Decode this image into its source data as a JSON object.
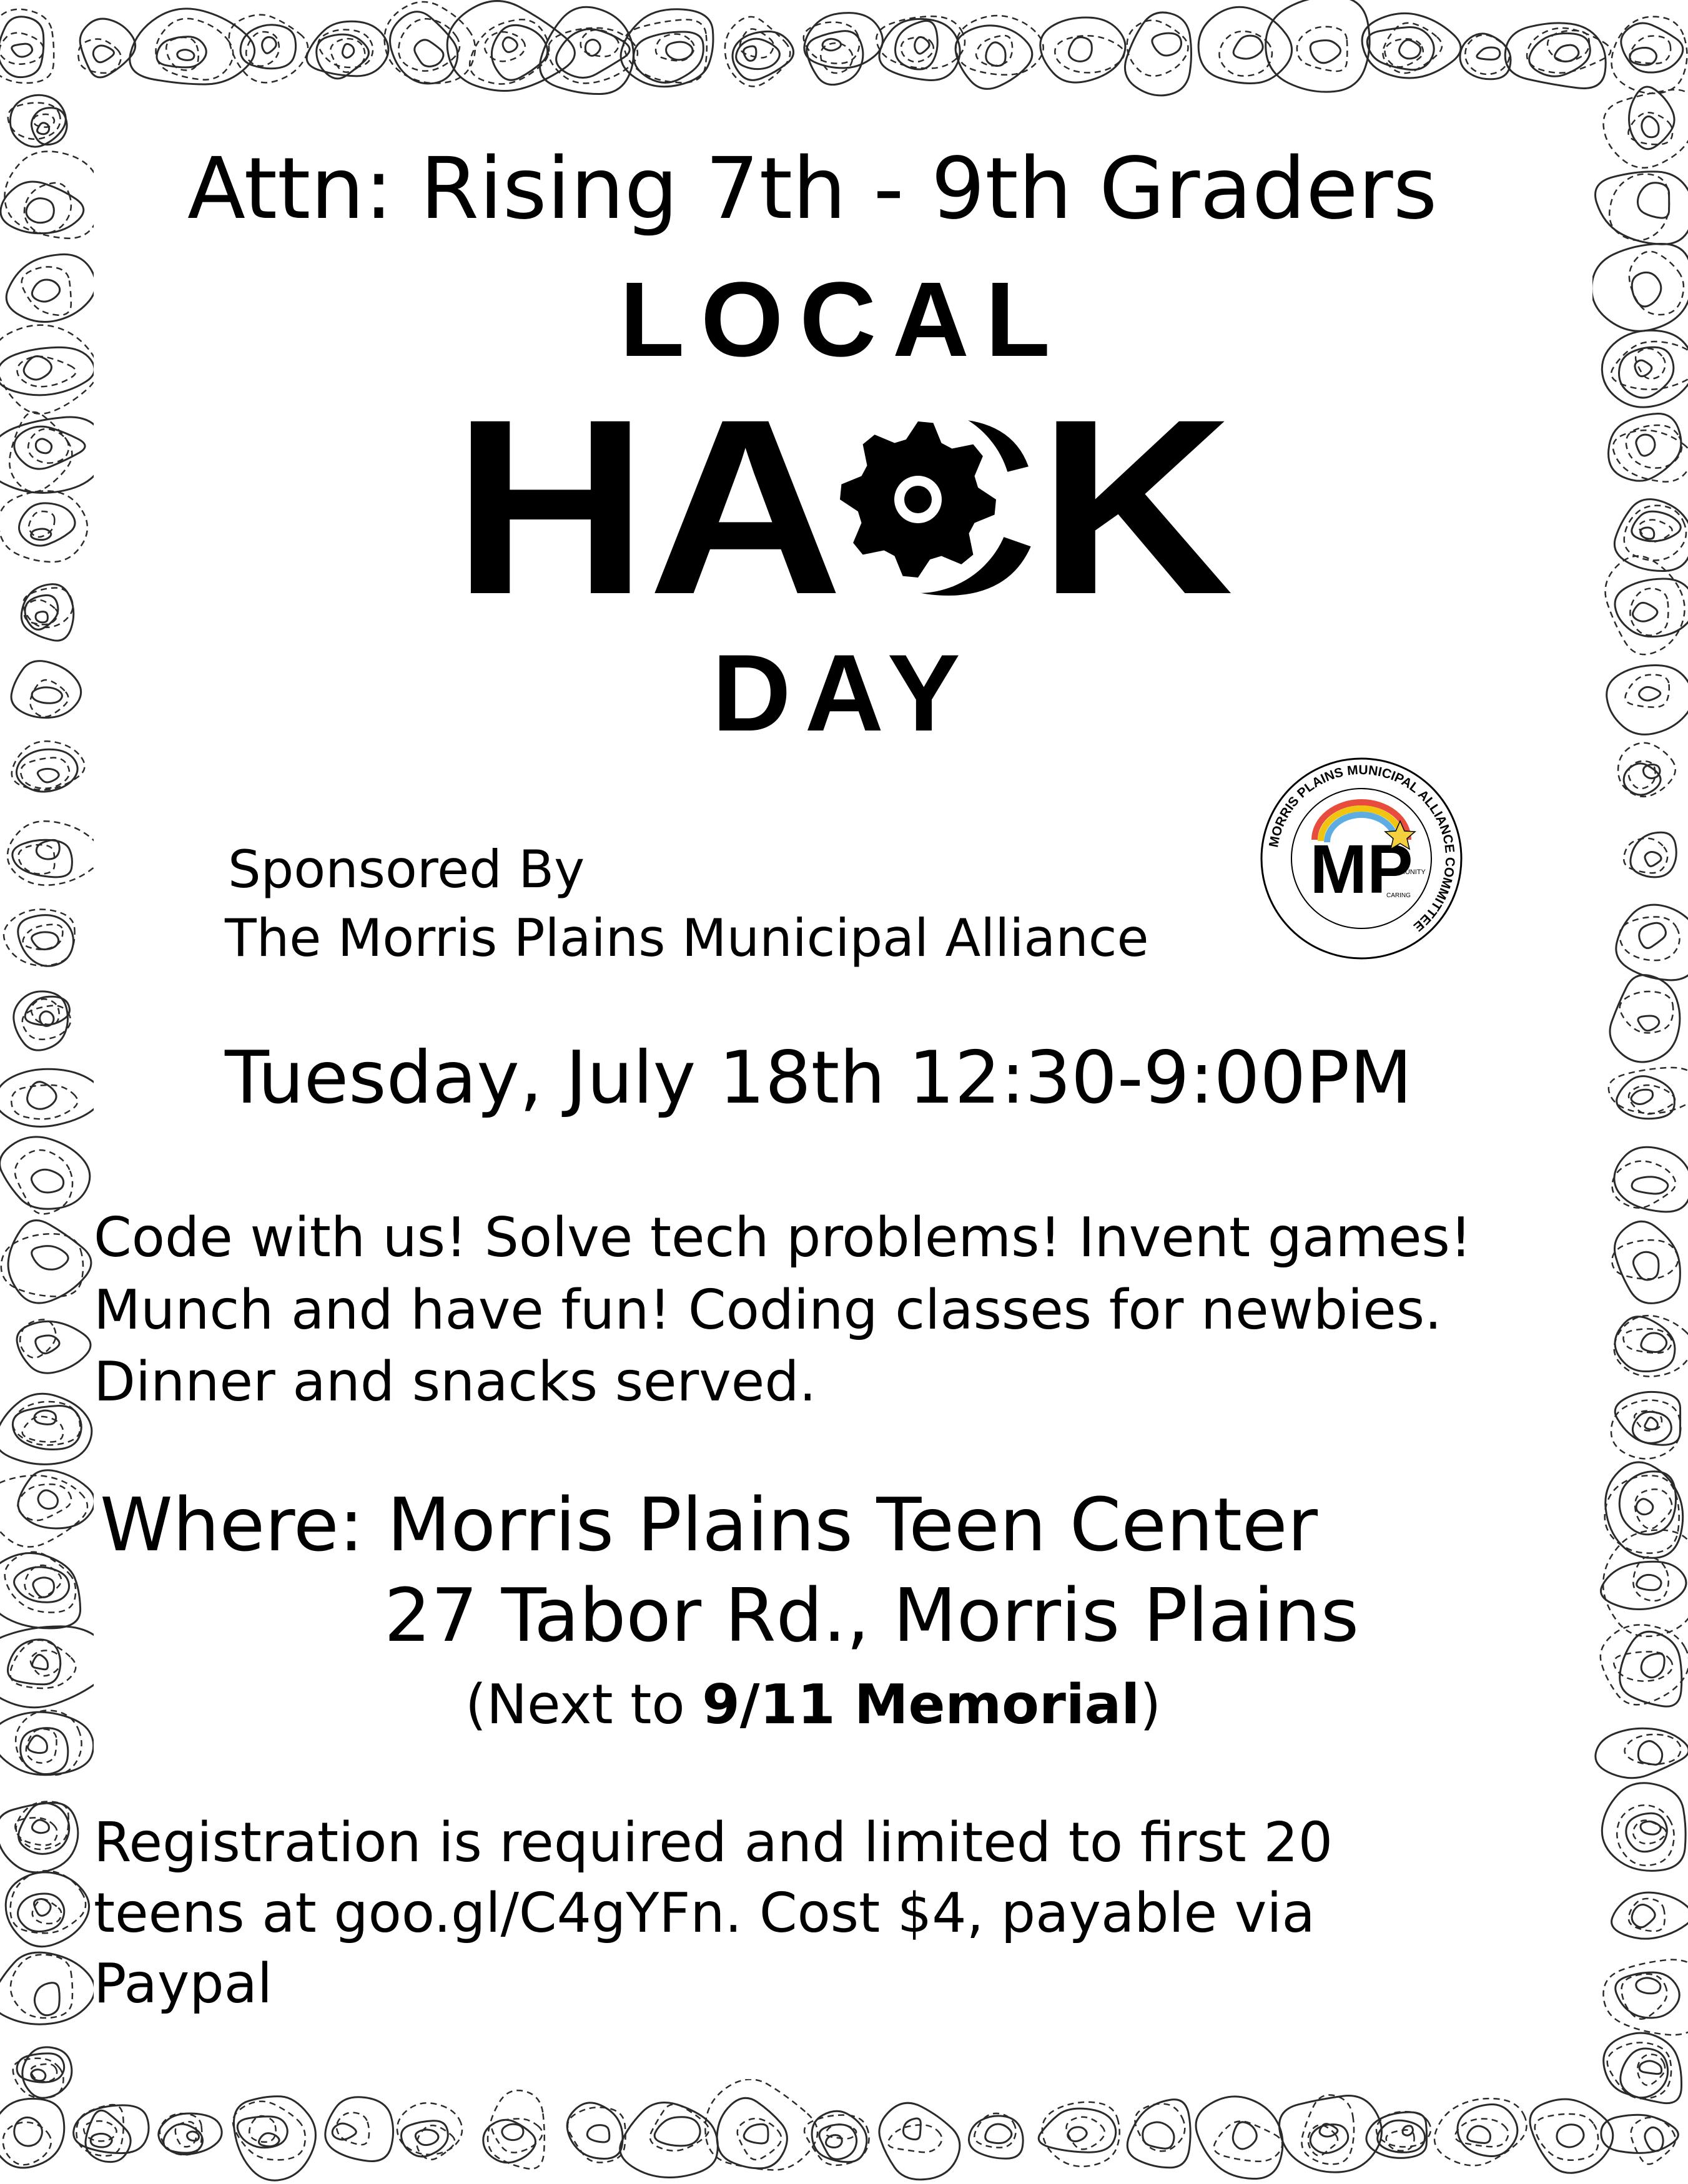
{
  "flyer": {
    "headline": "Attn: Rising 7th - 9th Graders",
    "logo": {
      "line1": "LOCAL",
      "line2": "HACK",
      "line3": "DAY",
      "icon": "gear-icon"
    },
    "sponsored_by_label": "Sponsored By",
    "sponsor_name": "The Morris Plains Municipal Alliance",
    "seal": {
      "ring_text": "MORRIS PLAINS MUNICIPAL ALLIANCE COMMITTEE",
      "monogram": "MP",
      "small_text_1": "COMMUNITY",
      "small_text_2": "CARING"
    },
    "datetime": "Tuesday, July 18th 12:30-9:00PM",
    "description": "Code with us! Solve tech problems! Invent games!\nMunch and have fun!  Coding classes for newbies.\nDinner and snacks served.",
    "where_line1": "Where: Morris Plains Teen Center",
    "where_line2": "27 Tabor Rd., Morris Plains",
    "next_to_prefix": "(Next to ",
    "next_to_landmark": "9/11 Memorial",
    "next_to_suffix": ")",
    "registration": "Registration is required and limited to first 20\nteens at goo.gl/C4gYFn.  Cost $4, payable via\nPaypal"
  },
  "colors": {
    "text": "#000000",
    "background": "#ffffff",
    "pattern_stroke": "#2a2a2a"
  }
}
